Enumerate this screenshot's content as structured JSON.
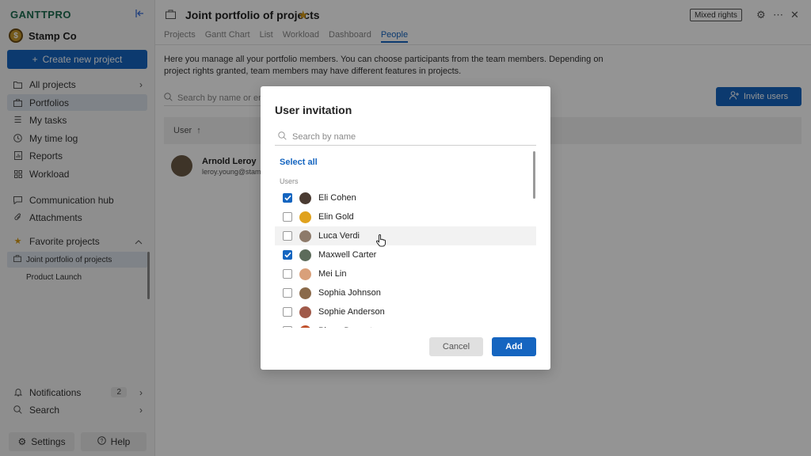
{
  "app": {
    "logo": "GANTTPRO",
    "workspace_name": "Stamp Co",
    "workspace_initial": "$"
  },
  "sidebar": {
    "create_label": "Create new project",
    "items": [
      {
        "label": "All projects"
      },
      {
        "label": "Portfolios"
      },
      {
        "label": "My tasks"
      },
      {
        "label": "My time log"
      },
      {
        "label": "Reports"
      },
      {
        "label": "Workload"
      },
      {
        "label": "Communication hub"
      },
      {
        "label": "Attachments"
      }
    ],
    "favorites_label": "Favorite projects",
    "favorites": [
      {
        "label": "Joint portfolio of projects"
      },
      {
        "label": "Product Launch"
      }
    ],
    "notifications_label": "Notifications",
    "notifications_count": "2",
    "search_label": "Search",
    "settings_label": "Settings",
    "help_label": "Help"
  },
  "header": {
    "title": "Joint portfolio of projects",
    "rights_badge": "Mixed rights",
    "tabs": [
      {
        "label": "Projects"
      },
      {
        "label": "Gantt Chart"
      },
      {
        "label": "List"
      },
      {
        "label": "Workload"
      },
      {
        "label": "Dashboard"
      },
      {
        "label": "People"
      }
    ]
  },
  "people": {
    "description": "Here you manage all your portfolio members. You can choose participants from the team members. Depending on project rights granted, team members may have different features in projects.",
    "search_placeholder": "Search by name or em",
    "invite_label": "Invite users",
    "column_user": "User",
    "members": [
      {
        "name": "Arnold Leroy",
        "email": "leroy.young@stam"
      }
    ]
  },
  "modal": {
    "title": "User invitation",
    "search_placeholder": "Search by name",
    "select_all": "Select all",
    "users_heading": "Users",
    "users": [
      {
        "name": "Eli Cohen",
        "checked": true,
        "avatar_color": "#4a3b32"
      },
      {
        "name": "Elin Gold",
        "checked": false,
        "avatar_color": "#e0a21e"
      },
      {
        "name": "Luca Verdi",
        "checked": false,
        "avatar_color": "#8d7a6a"
      },
      {
        "name": "Maxwell Carter",
        "checked": true,
        "avatar_color": "#5c6b5a"
      },
      {
        "name": "Mei Lin",
        "checked": false,
        "avatar_color": "#d9a07a"
      },
      {
        "name": "Sophia Johnson",
        "checked": false,
        "avatar_color": "#8a6a4a"
      },
      {
        "name": "Sophie Anderson",
        "checked": false,
        "avatar_color": "#a05a4a"
      },
      {
        "name": "Pierre Dupont",
        "checked": false,
        "avatar_color": "#c0502a"
      }
    ],
    "cancel_label": "Cancel",
    "add_label": "Add"
  }
}
